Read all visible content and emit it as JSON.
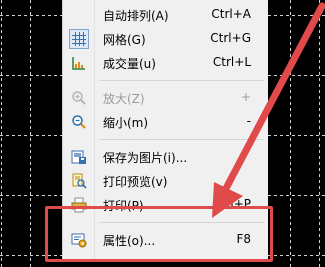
{
  "menu": {
    "items": [
      {
        "label": "自动排列(A)",
        "shortcut": "Ctrl+A",
        "icon": "none",
        "disabled": false
      },
      {
        "label": "网格(G)",
        "shortcut": "Ctrl+G",
        "icon": "grid-icon",
        "disabled": false,
        "checked": true
      },
      {
        "label": "成交量(u)",
        "shortcut": "Ctrl+L",
        "icon": "volume-icon",
        "disabled": false
      },
      {
        "label": "放大(Z)",
        "shortcut": "+",
        "icon": "zoom-in-icon",
        "disabled": true
      },
      {
        "label": "缩小(m)",
        "shortcut": "-",
        "icon": "zoom-out-icon",
        "disabled": false
      },
      {
        "label": "保存为图片(i)...",
        "shortcut": "",
        "icon": "save-image-icon",
        "disabled": false
      },
      {
        "label": "打印预览(v)",
        "shortcut": "",
        "icon": "print-preview-icon",
        "disabled": false
      },
      {
        "label": "打印(P)",
        "shortcut": "Ctrl+P",
        "icon": "print-icon",
        "disabled": false
      },
      {
        "label": "属性(o)...",
        "shortcut": "F8",
        "icon": "properties-icon",
        "disabled": false
      }
    ]
  },
  "colors": {
    "annotation": "#e04a4a",
    "background": "#000000",
    "grid": "#d0d0d0"
  }
}
